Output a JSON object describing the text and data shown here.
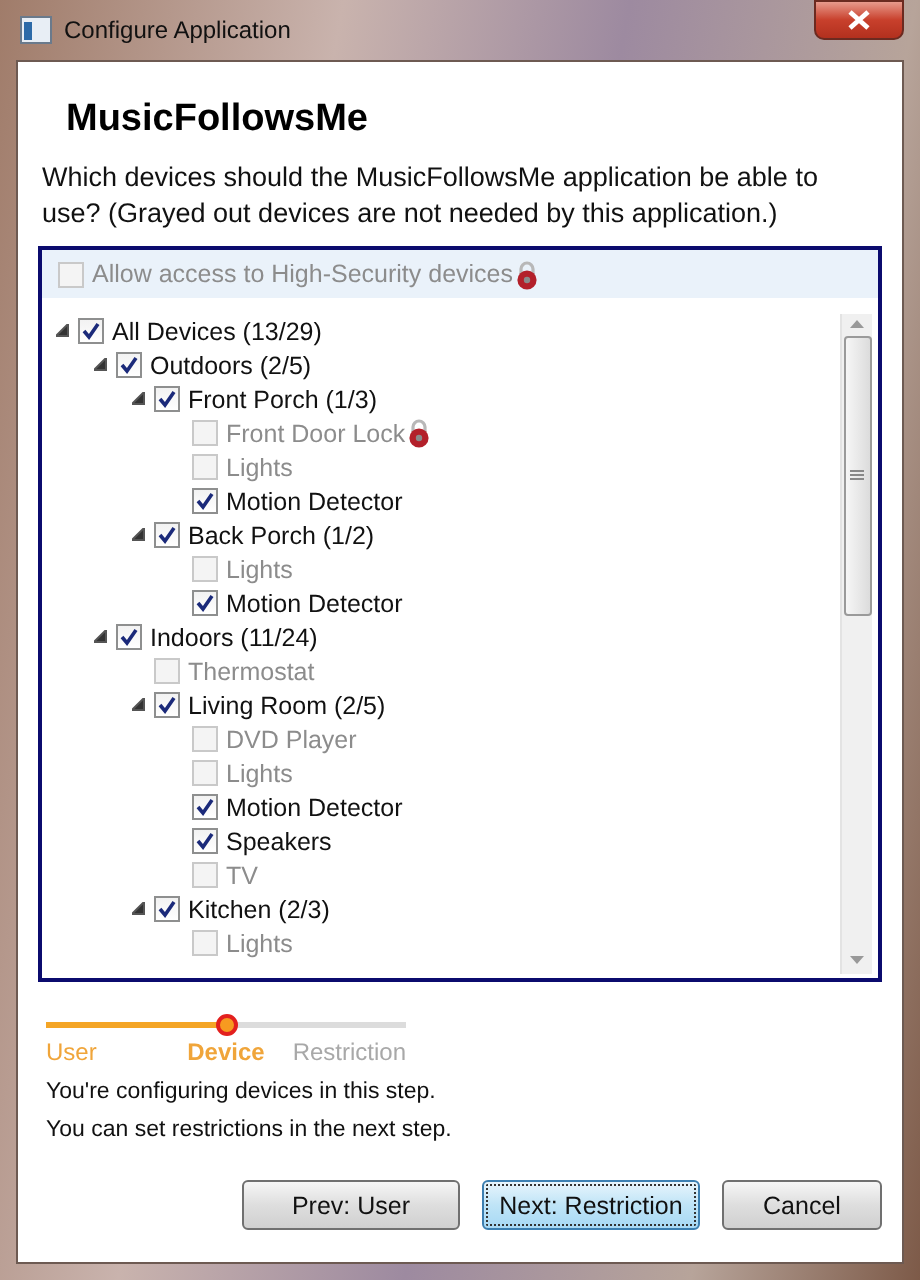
{
  "window": {
    "title": "Configure Application"
  },
  "heading": "MusicFollowsMe",
  "description": "Which devices should the MusicFollowsMe application be able to use? (Grayed out devices are not needed by this application.)",
  "high_security": {
    "label": "Allow access to High-Security devices",
    "checked": false,
    "disabled": true,
    "locked": true
  },
  "tree": [
    {
      "label": "All Devices (13/29)",
      "checked": true,
      "disabled": false,
      "expanded": true,
      "children": [
        {
          "label": "Outdoors (2/5)",
          "checked": true,
          "disabled": false,
          "expanded": true,
          "children": [
            {
              "label": "Front Porch (1/3)",
              "checked": true,
              "disabled": false,
              "expanded": true,
              "children": [
                {
                  "label": "Front Door Lock",
                  "checked": false,
                  "disabled": true,
                  "locked": true
                },
                {
                  "label": "Lights",
                  "checked": false,
                  "disabled": true
                },
                {
                  "label": "Motion Detector",
                  "checked": true,
                  "disabled": false
                }
              ]
            },
            {
              "label": "Back Porch (1/2)",
              "checked": true,
              "disabled": false,
              "expanded": true,
              "children": [
                {
                  "label": "Lights",
                  "checked": false,
                  "disabled": true
                },
                {
                  "label": "Motion Detector",
                  "checked": true,
                  "disabled": false
                }
              ]
            }
          ]
        },
        {
          "label": "Indoors (11/24)",
          "checked": true,
          "disabled": false,
          "expanded": true,
          "children": [
            {
              "label": "Thermostat",
              "checked": false,
              "disabled": true
            },
            {
              "label": "Living Room (2/5)",
              "checked": true,
              "disabled": false,
              "expanded": true,
              "children": [
                {
                  "label": "DVD Player",
                  "checked": false,
                  "disabled": true
                },
                {
                  "label": "Lights",
                  "checked": false,
                  "disabled": true
                },
                {
                  "label": "Motion Detector",
                  "checked": true,
                  "disabled": false
                },
                {
                  "label": "Speakers",
                  "checked": true,
                  "disabled": false
                },
                {
                  "label": "TV",
                  "checked": false,
                  "disabled": true
                }
              ]
            },
            {
              "label": "Kitchen (2/3)",
              "checked": true,
              "disabled": false,
              "expanded": true,
              "children": [
                {
                  "label": "Lights",
                  "checked": false,
                  "disabled": true
                }
              ]
            }
          ]
        }
      ]
    }
  ],
  "steps": [
    {
      "label": "User",
      "reached": true,
      "selected": false
    },
    {
      "label": "Device",
      "reached": true,
      "selected": true
    },
    {
      "label": "Restriction",
      "reached": false,
      "selected": false
    }
  ],
  "step_notes": [
    "You're configuring devices in this step.",
    "You can set restrictions in the next step."
  ],
  "buttons": [
    {
      "label": "Prev: User",
      "focused": false
    },
    {
      "label": "Next: Restriction",
      "focused": true
    },
    {
      "label": "Cancel",
      "focused": false
    }
  ]
}
